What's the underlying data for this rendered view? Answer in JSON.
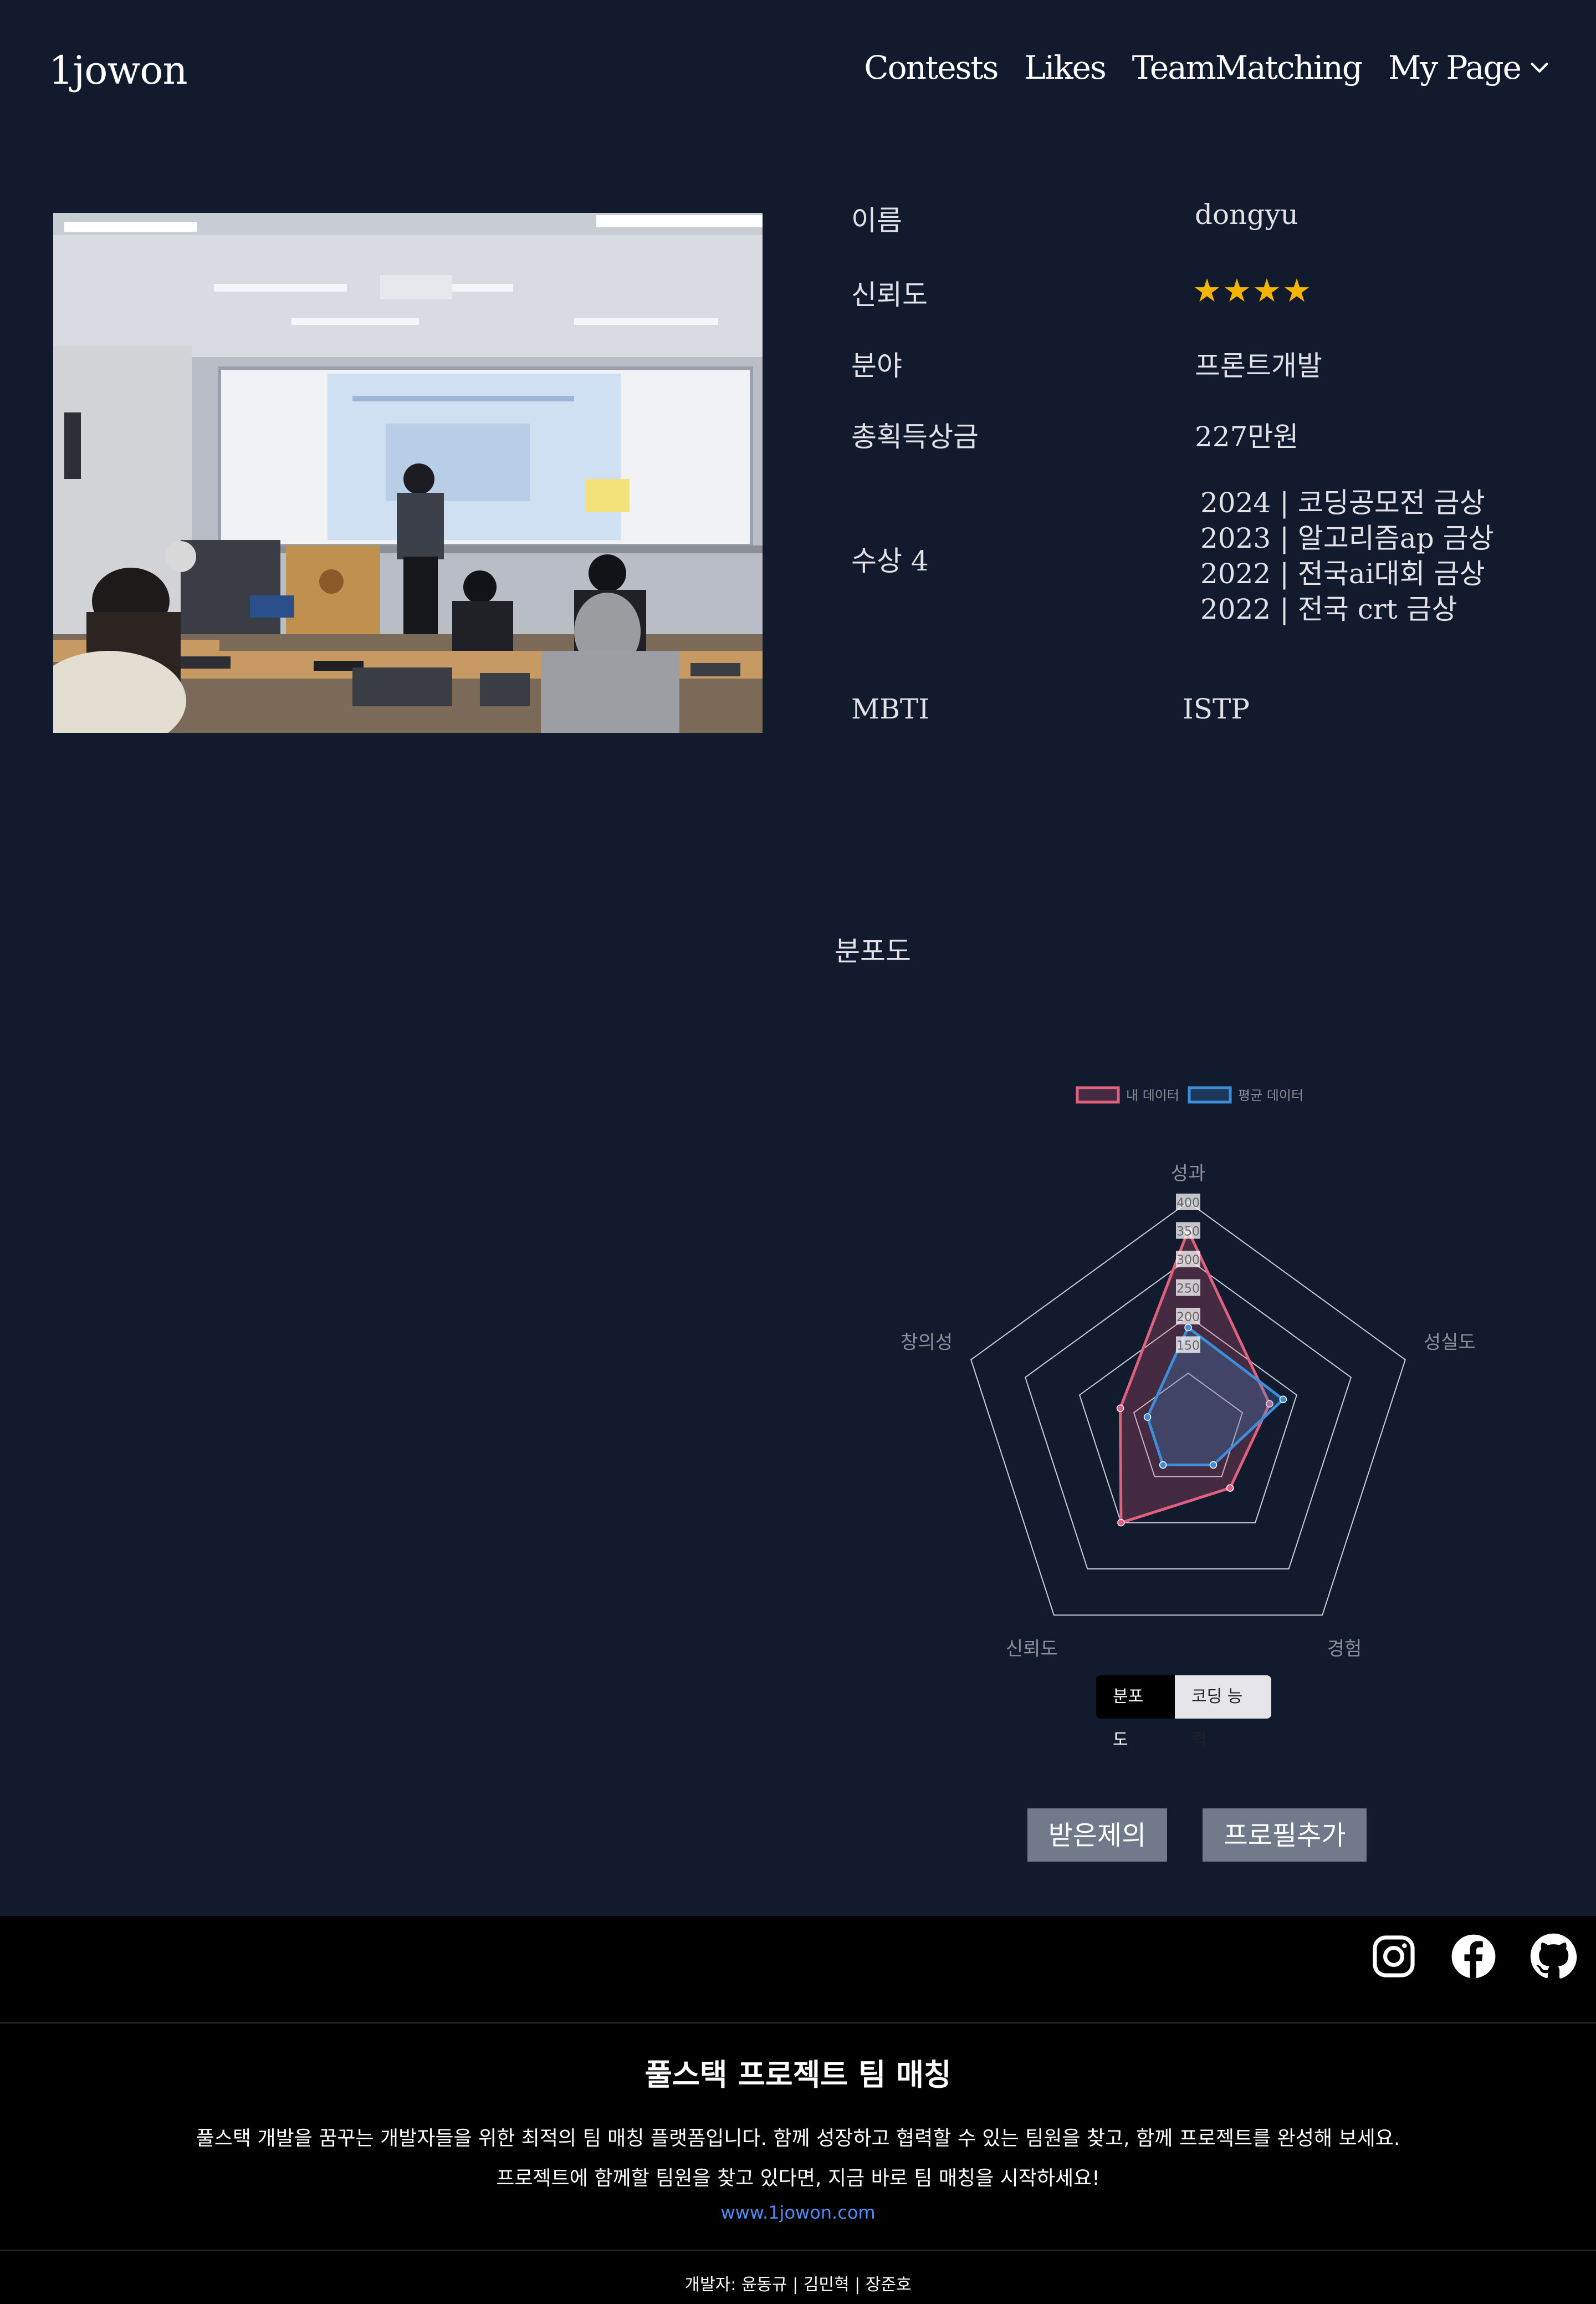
{
  "nav": {
    "logo": "1jowon",
    "links": [
      "Contests",
      "Likes",
      "TeamMatching",
      "My Page"
    ]
  },
  "profile": {
    "name_label": "이름",
    "name_value": "dongyu",
    "trust_label": "신뢰도",
    "trust_stars": "★★★★",
    "field_label": "분야",
    "field_value": "프론트개발",
    "prize_label": "총획득상금",
    "prize_value": "227만원",
    "awards_label": "수상 4",
    "awards": [
      "2024 | 코딩공모전 금상",
      "2023 | 알고리즘ap 금상",
      "2022 | 전국ai대회 금상",
      "2022 | 전국 crt 금상"
    ],
    "mbti_label": "MBTI",
    "mbti_value": "ISTP"
  },
  "section": {
    "title": "분포도"
  },
  "chart_data": {
    "type": "radar",
    "categories": [
      "성과",
      "성실도",
      "경험",
      "신뢰도",
      "창의성"
    ],
    "rlim": [
      0,
      400
    ],
    "ticks": [
      150,
      200,
      250,
      300,
      350,
      400
    ],
    "series": [
      {
        "name": "내 데이터",
        "color": "#e0607e",
        "values": [
          350,
          150,
          125,
          200,
          125
        ]
      },
      {
        "name": "평균 데이터",
        "color": "#3b8fd9",
        "values": [
          180,
          175,
          75,
          75,
          75
        ]
      }
    ],
    "legend": "top-center"
  },
  "tabs": [
    "분포도",
    "코딩 능력"
  ],
  "buttons": {
    "received": "받은제의",
    "add_profile": "프로필추가"
  },
  "footer": {
    "title": "풀스택 프로젝트 팀 매칭",
    "desc1": "풀스택 개발을 꿈꾸는 개발자들을 위한 최적의 팀 매칭 플랫폼입니다. 함께 성장하고 협력할 수 있는 팀원을 찾고, 함께 프로젝트를 완성해 보세요.",
    "desc2": "프로젝트에 함께할 팀원을 찾고 있다면, 지금 바로 팀 매칭을 시작하세요!",
    "url": "www.1jowon.com",
    "credits": "개발자: 윤동규 | 김민혁 | 장준호"
  },
  "icons": {
    "social": [
      "instagram-icon",
      "facebook-icon",
      "github-icon"
    ]
  }
}
